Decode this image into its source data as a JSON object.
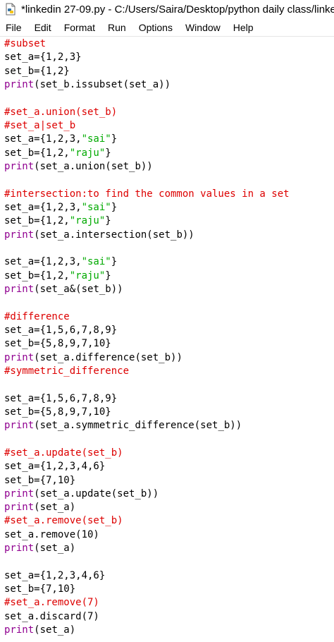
{
  "window": {
    "title": "*linkedin 27-09.py - C:/Users/Saira/Desktop/python daily class/linkedi"
  },
  "menu": [
    "File",
    "Edit",
    "Format",
    "Run",
    "Options",
    "Window",
    "Help"
  ],
  "colors": {
    "comment": "#dd0000",
    "builtin": "#900090",
    "string": "#00aa00",
    "default": "#000000"
  },
  "code_lines": [
    [
      {
        "t": "#subset",
        "c": "comment"
      }
    ],
    [
      {
        "t": "set_a={1,2,3}",
        "c": "default"
      }
    ],
    [
      {
        "t": "set_b={1,2}",
        "c": "default"
      }
    ],
    [
      {
        "t": "print",
        "c": "builtin"
      },
      {
        "t": "(set_b.issubset(set_a))",
        "c": "default"
      }
    ],
    [],
    [
      {
        "t": "#set_a.union(set_b)",
        "c": "comment"
      }
    ],
    [
      {
        "t": "#set_a|set_b",
        "c": "comment"
      }
    ],
    [
      {
        "t": "set_a={1,2,3,",
        "c": "default"
      },
      {
        "t": "\"sai\"",
        "c": "string"
      },
      {
        "t": "}",
        "c": "default"
      }
    ],
    [
      {
        "t": "set_b={1,2,",
        "c": "default"
      },
      {
        "t": "\"raju\"",
        "c": "string"
      },
      {
        "t": "}",
        "c": "default"
      }
    ],
    [
      {
        "t": "print",
        "c": "builtin"
      },
      {
        "t": "(set_a.union(set_b))",
        "c": "default"
      }
    ],
    [],
    [
      {
        "t": "#intersection:to find the common values in a set",
        "c": "comment"
      }
    ],
    [
      {
        "t": "set_a={1,2,3,",
        "c": "default"
      },
      {
        "t": "\"sai\"",
        "c": "string"
      },
      {
        "t": "}",
        "c": "default"
      }
    ],
    [
      {
        "t": "set_b={1,2,",
        "c": "default"
      },
      {
        "t": "\"raju\"",
        "c": "string"
      },
      {
        "t": "}",
        "c": "default"
      }
    ],
    [
      {
        "t": "print",
        "c": "builtin"
      },
      {
        "t": "(set_a.intersection(set_b))",
        "c": "default"
      }
    ],
    [],
    [
      {
        "t": "set_a={1,2,3,",
        "c": "default"
      },
      {
        "t": "\"sai\"",
        "c": "string"
      },
      {
        "t": "}",
        "c": "default"
      }
    ],
    [
      {
        "t": "set_b={1,2,",
        "c": "default"
      },
      {
        "t": "\"raju\"",
        "c": "string"
      },
      {
        "t": "}",
        "c": "default"
      }
    ],
    [
      {
        "t": "print",
        "c": "builtin"
      },
      {
        "t": "(set_a&(set_b))",
        "c": "default"
      }
    ],
    [],
    [
      {
        "t": "#difference",
        "c": "comment"
      }
    ],
    [
      {
        "t": "set_a={1,5,6,7,8,9}",
        "c": "default"
      }
    ],
    [
      {
        "t": "set_b={5,8,9,7,10}",
        "c": "default"
      }
    ],
    [
      {
        "t": "print",
        "c": "builtin"
      },
      {
        "t": "(set_a.difference(set_b))",
        "c": "default"
      }
    ],
    [
      {
        "t": "#symmetric_difference",
        "c": "comment"
      }
    ],
    [],
    [
      {
        "t": "set_a={1,5,6,7,8,9}",
        "c": "default"
      }
    ],
    [
      {
        "t": "set_b={5,8,9,7,10}",
        "c": "default"
      }
    ],
    [
      {
        "t": "print",
        "c": "builtin"
      },
      {
        "t": "(set_a.symmetric_difference(set_b))",
        "c": "default"
      }
    ],
    [],
    [
      {
        "t": "#set_a.update(set_b)",
        "c": "comment"
      }
    ],
    [
      {
        "t": "set_a={1,2,3,4,6}",
        "c": "default"
      }
    ],
    [
      {
        "t": "set_b={7,10}",
        "c": "default"
      }
    ],
    [
      {
        "t": "print",
        "c": "builtin"
      },
      {
        "t": "(set_a.update(set_b))",
        "c": "default"
      }
    ],
    [
      {
        "t": "print",
        "c": "builtin"
      },
      {
        "t": "(set_a)",
        "c": "default"
      }
    ],
    [
      {
        "t": "#set_a.remove(set_b)",
        "c": "comment"
      }
    ],
    [
      {
        "t": "set_a.remove(10)",
        "c": "default"
      }
    ],
    [
      {
        "t": "print",
        "c": "builtin"
      },
      {
        "t": "(set_a)",
        "c": "default"
      }
    ],
    [],
    [
      {
        "t": "set_a={1,2,3,4,6}",
        "c": "default"
      }
    ],
    [
      {
        "t": "set_b={7,10}",
        "c": "default"
      }
    ],
    [
      {
        "t": "#set_a.remove(7)",
        "c": "comment"
      }
    ],
    [
      {
        "t": "set_a.discard(7)",
        "c": "default"
      }
    ],
    [
      {
        "t": "print",
        "c": "builtin"
      },
      {
        "t": "(set_a)",
        "c": "default"
      }
    ]
  ]
}
